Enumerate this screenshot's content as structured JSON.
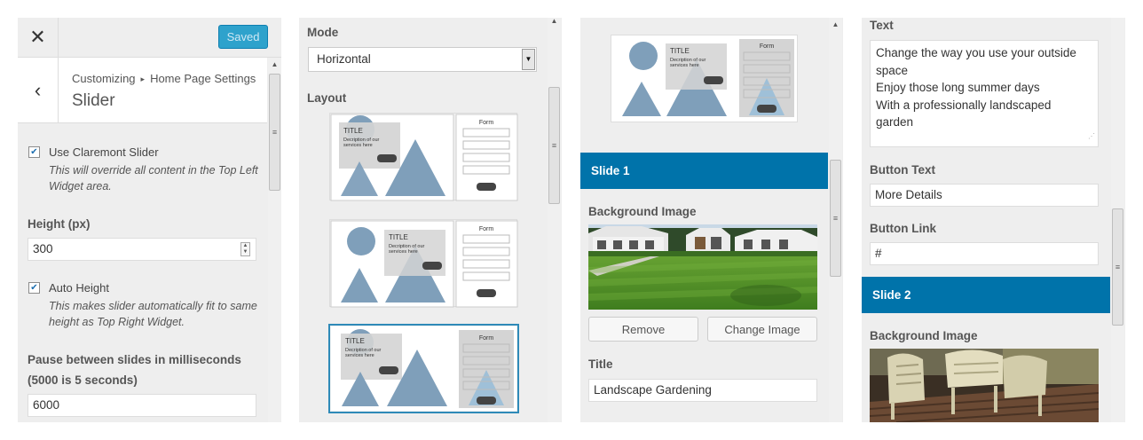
{
  "header": {
    "close_icon": "close-icon",
    "saved_label": "Saved",
    "back_icon": "back-arrow-icon",
    "breadcrumb_root": "Customizing",
    "breadcrumb_separator_icon": "triangle-right-icon",
    "breadcrumb_parent": "Home Page Settings",
    "section_title": "Slider"
  },
  "settings": {
    "use_slider_label": "Use Claremont Slider",
    "use_slider_checked": true,
    "use_slider_desc": "This will override all content in the Top Left Widget area.",
    "height_label": "Height (px)",
    "height_value": "300",
    "auto_height_label": "Auto Height",
    "auto_height_checked": true,
    "auto_height_desc": "This makes slider automatically fit to same height as Top Right Widget.",
    "pause_label_line1": "Pause between slides in milliseconds",
    "pause_label_line2": "(5000 is 5 seconds)",
    "pause_value": "6000"
  },
  "layout_panel": {
    "mode_label": "Mode",
    "mode_value": "Horizontal",
    "layout_label": "Layout",
    "thumb_title": "TITLE",
    "thumb_desc_line1": "Decription of our",
    "thumb_desc_line2": "services here",
    "thumb_form": "Form",
    "selected_layout_index": 2
  },
  "slides": {
    "slide1_header": "Slide 1",
    "slide1_bg_label": "Background Image",
    "remove_label": "Remove",
    "change_image_label": "Change Image",
    "title_label": "Title",
    "title_value": "Landscape Gardening",
    "text_label": "Text",
    "text_lines": [
      "Change the way you use your outside",
      "space",
      "Enjoy those long summer days",
      "With a professionally landscaped",
      "garden"
    ],
    "button_text_label": "Button Text",
    "button_text_value": "More Details",
    "button_link_label": "Button Link",
    "button_link_value": "#",
    "slide2_header": "Slide 2",
    "slide2_bg_label": "Background Image"
  },
  "colors": {
    "accent": "#0073aa",
    "saved_button": "#2ea2cc",
    "panel_bg": "#eeeeee",
    "thumb_shape": "#7f9fba"
  }
}
